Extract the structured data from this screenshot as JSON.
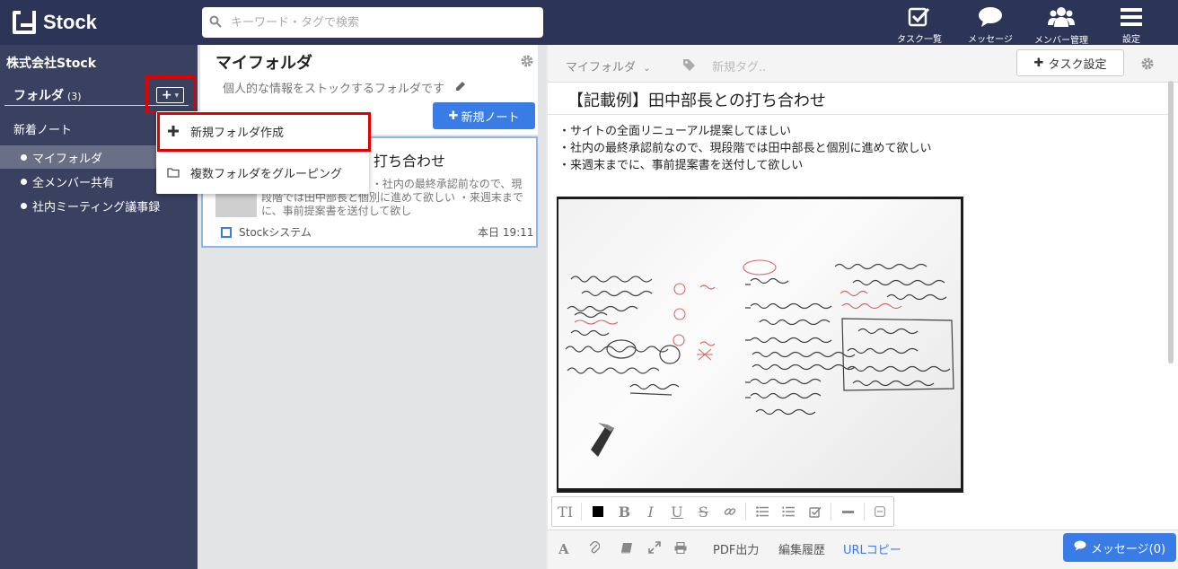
{
  "app": {
    "name": "Stock"
  },
  "search": {
    "placeholder": "キーワード・タグで検索"
  },
  "topnav": [
    {
      "label": "タスク一覧",
      "icon": "task-check-icon"
    },
    {
      "label": "メッセージ",
      "icon": "chat-bubble-icon"
    },
    {
      "label": "メンバー管理",
      "icon": "members-icon"
    },
    {
      "label": "設定",
      "icon": "hamburger-menu-icon"
    }
  ],
  "sidebar": {
    "company": "株式会社Stock",
    "folder_label": "フォルダ",
    "folder_count": "(3)",
    "recent_notes": "新着ノート",
    "folders": [
      {
        "label": "マイフォルダ",
        "active": true
      },
      {
        "label": "全メンバー共有",
        "active": false
      },
      {
        "label": "社内ミーティング議事録",
        "active": false
      }
    ]
  },
  "dropdown": {
    "items": [
      {
        "label": "新規フォルダ作成",
        "icon": "plus-icon"
      },
      {
        "label": "複数フォルダをグルーピング",
        "icon": "folder-icon"
      }
    ]
  },
  "middle": {
    "title": "マイフォルダ",
    "description": "個人的な情報をストックするフォルダです",
    "new_note": "新規ノート",
    "note": {
      "title": "打ち合わせ",
      "excerpt": "ーアル提案してほしい ・社内の最終承認前なので、現段階では田中部長と個別に進めて欲しい ・来週末までに、事前提案書を送付して欲し",
      "owner": "Stockシステム",
      "time": "本日 19:11"
    }
  },
  "right": {
    "folder": "マイフォルダ",
    "new_tag": "新規タグ..",
    "task_settings": "タスク設定",
    "title": "【記載例】田中部長との打ち合わせ",
    "body": [
      "・サイトの全面リニューアル提案してほしい",
      "・社内の最終承認前なので、現段階では田中部長と個別に進めて欲しい",
      "・来週末までに、事前提案書を送付して欲しい"
    ],
    "bottom": {
      "pdf": "PDF出力",
      "history": "編集履歴",
      "url_copy": "URLコピー",
      "message": "メッセージ(0)"
    }
  },
  "colors": {
    "topbar": "#2c3558",
    "sidebar": "#3a4060",
    "accent": "#3a7ce6",
    "highlight": "#e00000"
  }
}
